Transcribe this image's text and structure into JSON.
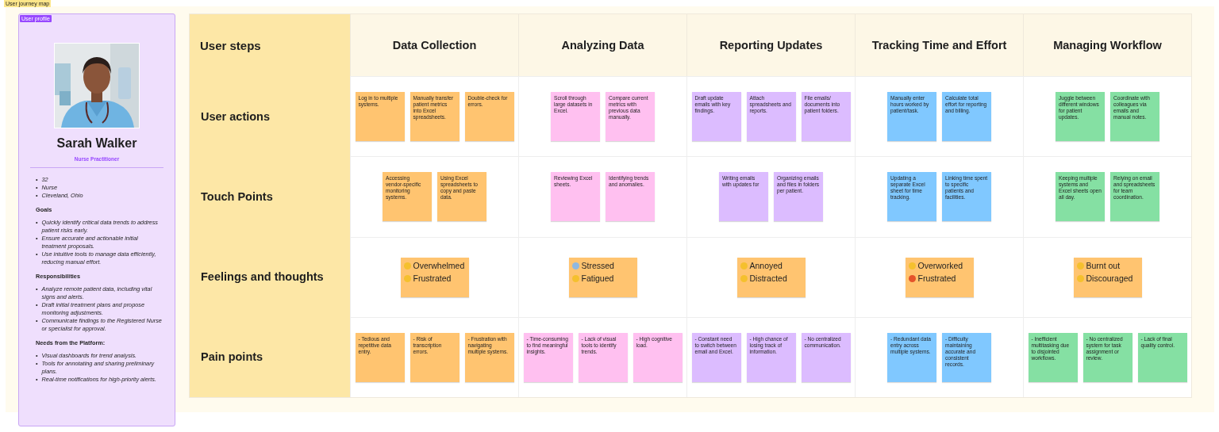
{
  "frame_label": "User journey map",
  "persona": {
    "tag": "User profile",
    "bullet": "•",
    "name": "Sarah Walker",
    "role": "Nurse Practitioner",
    "facts": [
      "32",
      "Nurse",
      "Cleveland, Ohio"
    ],
    "sections": [
      {
        "title": "Goals",
        "items": [
          "Quickly identify critical data trends to address patient risks early.",
          "Ensure accurate and actionable initial treatment proposals.",
          "Use intuitive tools to manage data efficiently, reducing manual effort."
        ]
      },
      {
        "title": "Responsibilities",
        "items": [
          "Analyze remote patient data, including vital signs and alerts.",
          "Draft initial treatment plans and propose monitoring adjustments.",
          "Communicate findings to the Registered Nurse or specialist for approval."
        ]
      },
      {
        "title": "Needs from the Platform:",
        "items": [
          "Visual dashboards for trend analysis.",
          "Tools for annotating and sharing preliminary plans.",
          "Real-time notifications for high-priority alerts."
        ]
      }
    ]
  },
  "journey": {
    "corner": "User steps",
    "stages": [
      "Data Collection",
      "Analyzing Data",
      "Reporting Updates",
      "Tracking Time and Effort",
      "Managing Workflow"
    ],
    "rows": [
      {
        "label": "User actions",
        "kind": "notes",
        "cells": [
          {
            "color": "#ffc470",
            "notes": [
              "Log in to multiple systems.",
              "Manually transfer patient metrics into Excel spreadsheets.",
              "Double-check for errors."
            ]
          },
          {
            "color": "#ffc0f0",
            "notes": [
              "Scroll through large datasets in Excel.",
              "Compare current metrics with previous data manually."
            ]
          },
          {
            "color": "#dcbcff",
            "notes": [
              "Draft update emails with key findings.",
              "Attach spreadsheets and reports.",
              "File emails/ documents into patient folders."
            ]
          },
          {
            "color": "#80c8ff",
            "notes": [
              "Manually enter hours worked by patient/task.",
              "Calculate total effort for reporting and billing."
            ]
          },
          {
            "color": "#85e0a3",
            "notes": [
              "Juggle between different windows for patient updates.",
              "Coordinate with colleagues via emails and manual notes."
            ]
          }
        ]
      },
      {
        "label": "Touch Points",
        "kind": "notes",
        "cells": [
          {
            "color": "#ffc470",
            "notes": [
              "Accessing vendor-specific monitoring systems.",
              "Using Excel spreadsheets to copy and paste data."
            ]
          },
          {
            "color": "#ffc0f0",
            "notes": [
              "Reviewing Excel sheets.",
              "Identifying trends and anomalies."
            ]
          },
          {
            "color": "#dcbcff",
            "notes": [
              "Writing emails with updates for",
              "Organizing emails and files in folders per patient."
            ]
          },
          {
            "color": "#80c8ff",
            "notes": [
              "Updating a separate Excel sheet for time tracking.",
              "Linking time spent to specific patients and facilities."
            ]
          },
          {
            "color": "#85e0a3",
            "notes": [
              "Keeping multiple systems and Excel sheets open all day.",
              "Relying on email and spreadsheets for team coordination."
            ]
          }
        ]
      },
      {
        "label": "Feelings and thoughts",
        "kind": "feelings",
        "cells": [
          {
            "color": "#ffc470",
            "feelings": [
              {
                "text": "Overwhelmed",
                "color": "#f5c02e"
              },
              {
                "text": "Frustrated",
                "color": "#f5c02e"
              }
            ]
          },
          {
            "color": "#ffc470",
            "feelings": [
              {
                "text": "Stressed",
                "color": "#8fb8e0"
              },
              {
                "text": "Fatigued",
                "color": "#f5c02e"
              }
            ]
          },
          {
            "color": "#ffc470",
            "feelings": [
              {
                "text": "Annoyed",
                "color": "#f5c02e"
              },
              {
                "text": "Distracted",
                "color": "#f5c02e"
              }
            ]
          },
          {
            "color": "#ffc470",
            "feelings": [
              {
                "text": "Overworked",
                "color": "#f5c02e"
              },
              {
                "text": "Frustrated",
                "color": "#e5532a"
              }
            ]
          },
          {
            "color": "#ffc470",
            "feelings": [
              {
                "text": "Burnt out",
                "color": "#f5c02e"
              },
              {
                "text": "Discouraged",
                "color": "#f5c02e"
              }
            ]
          }
        ]
      },
      {
        "label": "Pain points",
        "kind": "notes",
        "cells": [
          {
            "color": "#ffc470",
            "notes": [
              "- Tedious and repetitive data entry.",
              "- Risk of transcription errors.",
              "- Frustration with navigating multiple systems."
            ]
          },
          {
            "color": "#ffc0f0",
            "notes": [
              "- Time-consuming to find meaningful insights.",
              "- Lack of visual tools to identify trends.",
              "- High cognitive load."
            ]
          },
          {
            "color": "#dcbcff",
            "notes": [
              "- Constant need to switch between email and Excel.",
              "- High chance of losing track of information.",
              "- No centralized communication."
            ]
          },
          {
            "color": "#80c8ff",
            "notes": [
              "- Redundant data entry across multiple systems.",
              "- Difficulty maintaining accurate and consistent records."
            ]
          },
          {
            "color": "#85e0a3",
            "notes": [
              "- Inefficient multitasking due to disjointed workflows.",
              "- No centralized system for task assignment or review.",
              "- Lack of final quality control."
            ]
          }
        ]
      }
    ]
  }
}
